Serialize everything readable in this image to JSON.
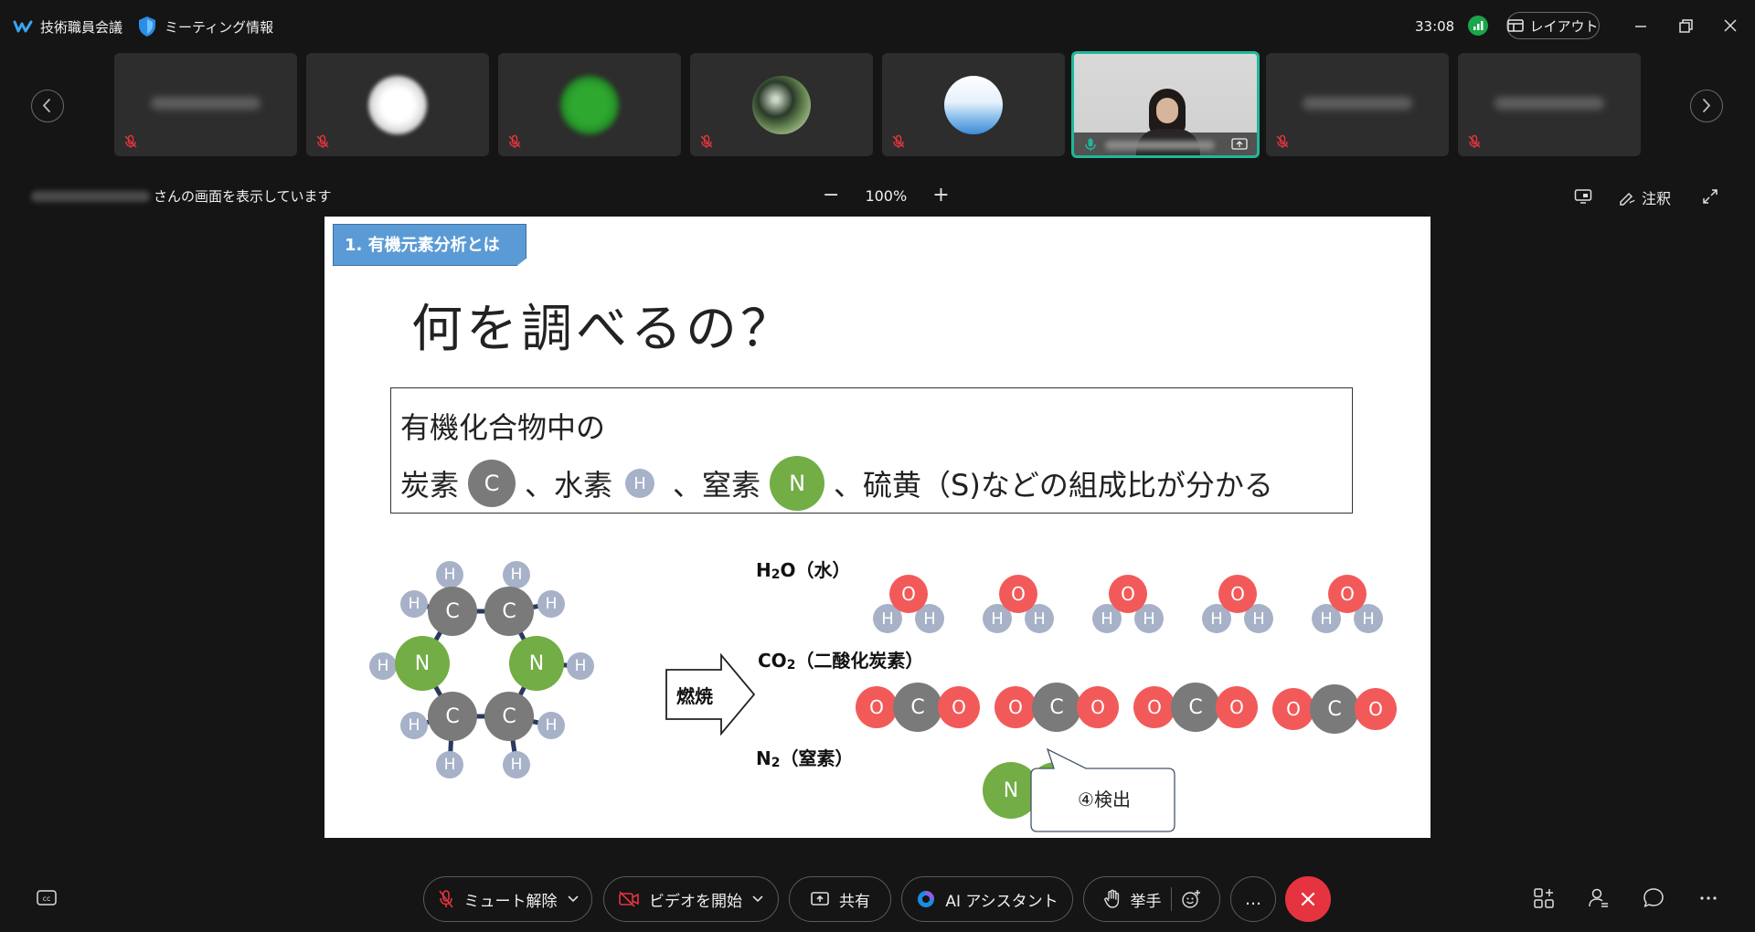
{
  "app": {
    "meeting_title": "技術職員会議",
    "meeting_info_label": "ミーティング情報",
    "timer": "33:08",
    "layout_label": "レイアウト"
  },
  "share": {
    "viewing_suffix": "さんの画面を表示しています",
    "zoom_level": "100%",
    "zoom_minus": "−",
    "zoom_plus": "+",
    "annotate_label": "注釈"
  },
  "slide": {
    "section_tag": "1. 有機元素分析とは",
    "title": "何を調べるの？",
    "summary_line1": "有機化合物中の",
    "summary_parts": {
      "carbon": "炭素",
      "sep1": "、水素",
      "sep2": "、窒素",
      "rest": "、硫黄（S)などの組成比が分かる"
    },
    "atom_letters": {
      "C": "C",
      "H": "H",
      "N": "N",
      "O": "O"
    },
    "arrow_label": "燃焼",
    "products": {
      "h2o": {
        "formula_main": "H",
        "formula_sub": "2",
        "formula_tail": "O（水）"
      },
      "co2": {
        "formula_main": "CO",
        "formula_sub": "2",
        "formula_tail": "（二酸化炭素）"
      },
      "n2": {
        "formula_main": "N",
        "formula_sub": "2",
        "formula_tail": "（窒素）"
      }
    },
    "callout": "④検出"
  },
  "toolbar": {
    "unmute_label": "ミュート解除",
    "video_label": "ビデオを開始",
    "share_label": "共有",
    "ai_label": "AI アシスタント",
    "raise_hand_label": "挙手",
    "more_label": "…"
  },
  "colors": {
    "accent_green": "#1fb89a",
    "leave_red": "#e5343f",
    "muted_red": "#e5343f",
    "carbon": "#7a7a7a",
    "hydrogen": "#a7b2c8",
    "nitrogen": "#72ad45",
    "oxygen": "#f25a5a",
    "tag_blue": "#5b9bd5"
  }
}
